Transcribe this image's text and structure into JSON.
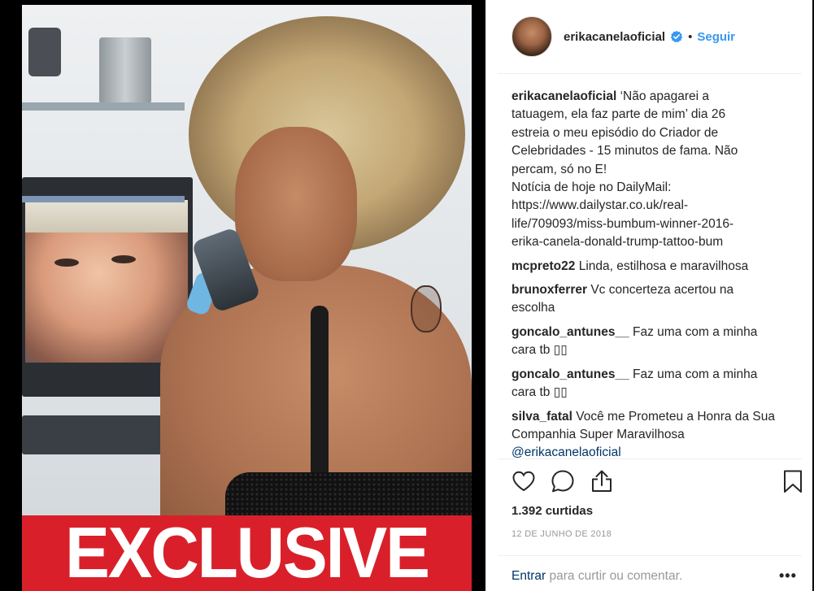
{
  "post": {
    "media": {
      "overlay_text": "EXCLUSIVE",
      "overlay_color": "#d9202a"
    },
    "header": {
      "username": "erikacanelaoficial",
      "verified_icon": "verified-badge-icon",
      "separator": "•",
      "follow_label": "Seguir",
      "follow_color": "#3897f0"
    },
    "caption": {
      "user": "erikacanelaoficial",
      "lines": [
        "‘Não apagarei a",
        "tatuagem, ela faz parte de mim’ dia 26",
        "estreia o meu episódio do Criador de",
        "Celebridades - 15 minutos de fama. Não",
        "percam, só no E!",
        "Notícia de hoje no DailyMail:",
        "https://www.dailystar.co.uk/real-",
        "life/709093/miss-bumbum-winner-2016-",
        "erika-canela-donald-trump-tattoo-bum"
      ]
    },
    "comments": [
      {
        "user": "mcpreto22",
        "text": "Linda, estilhosa e maravilhosa"
      },
      {
        "user": "brunoxferrer",
        "text": "Vc concerteza acertou na escolha"
      },
      {
        "user": "goncalo_antunes__",
        "text": "Faz uma com a minha cara tb ▯▯"
      },
      {
        "user": "goncalo_antunes__",
        "text": "Faz uma com a minha cara tb ▯▯"
      },
      {
        "user": "silva_fatal",
        "text": "Você me Prometeu a Honra da Sua Companhia Super Maravilhosa",
        "mention": "@erikacanelaoficial"
      }
    ],
    "actions": {
      "icons": [
        "heart-icon",
        "comment-icon",
        "share-icon",
        "bookmark-icon"
      ]
    },
    "likes_label": "1.392 curtidas",
    "date_label": "12 DE JUNHO DE 2018",
    "login": {
      "link_label": "Entrar",
      "rest_label": " para curtir ou comentar.",
      "more_label": "•••"
    }
  }
}
